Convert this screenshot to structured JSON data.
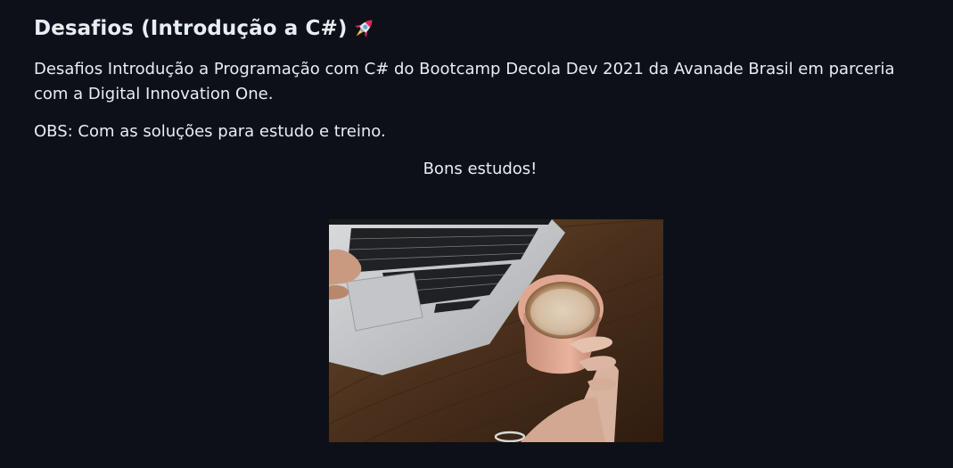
{
  "readme": {
    "title": "Desafios (Introdução a C#)",
    "title_icon": "rocket-icon",
    "description": "Desafios Introdução a Programação com C# do Bootcamp Decola Dev 2021 da Avanade Brasil em parceria com a Digital Innovation One.",
    "obs": "OBS: Com as soluções para estudo e treino.",
    "closing": "Bons estudos!",
    "image_subject": "laptop-and-coffee-photo"
  },
  "colors": {
    "background": "#0d1117",
    "text": "#e6edf3"
  }
}
